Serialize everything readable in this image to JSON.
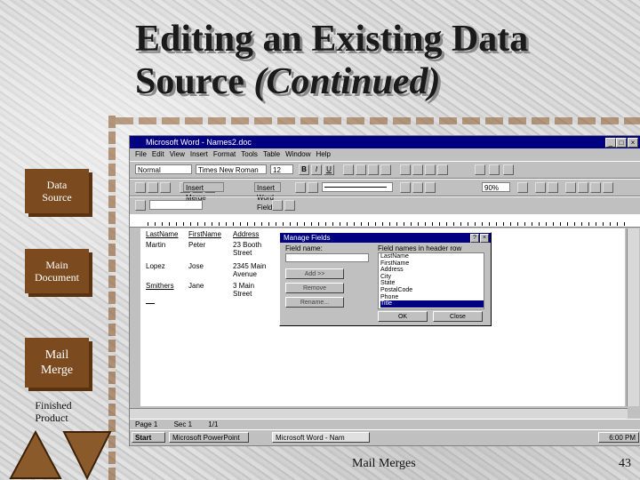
{
  "title": {
    "line1": "Editing an Existing Data",
    "line2_plain": "Source ",
    "line2_italic": "(Continued)"
  },
  "sidebar": [
    {
      "label": "Data\nSource",
      "style": "box"
    },
    {
      "label": "Main\nDocument",
      "style": "box"
    },
    {
      "label": "Mail\nMerge",
      "style": "box"
    },
    {
      "label": "Finished\nProduct",
      "style": "plain"
    }
  ],
  "window": {
    "title": "Microsoft Word - Names2.doc",
    "menu": [
      "File",
      "Edit",
      "View",
      "Insert",
      "Format",
      "Tools",
      "Table",
      "Window",
      "Help"
    ],
    "style_box": "Normal",
    "font_box": "Times New Roman",
    "size_box": "12",
    "zoom_box": "90%",
    "merge_field_btn": "Insert Merge Field",
    "word_field_btn": "Insert Word Field"
  },
  "table": {
    "headers": [
      "LastName",
      "FirstName",
      "Address"
    ],
    "rows": [
      [
        "Martin",
        "Peter",
        "23 Booth Street"
      ],
      [
        "Lopez",
        "Jose",
        "2345 Main Avenue"
      ],
      [
        "Smithers",
        "Jane",
        "3 Main Street"
      ]
    ]
  },
  "dialog": {
    "title": "Manage Fields",
    "field_name_label": "Field name:",
    "field_names_label": "Field names in header row",
    "add_button": "Add >>",
    "remove_button": "Remove",
    "rename_button": "Rename...",
    "ok_button": "OK",
    "close_button": "Close",
    "fields": [
      "LastName",
      "FirstName",
      "Address",
      "City",
      "State",
      "PostalCode",
      "Phone",
      "Title"
    ],
    "selected_index": 7
  },
  "status": {
    "page": "Page 1",
    "sec": "Sec 1",
    "pos": "1/1"
  },
  "taskbar": {
    "start": "Start",
    "tasks": [
      "Microsoft PowerPoint",
      "Microsoft Word - Nam"
    ],
    "clock": "6:00 PM"
  },
  "footer": {
    "center": "Mail Merges",
    "page_number": "43"
  }
}
